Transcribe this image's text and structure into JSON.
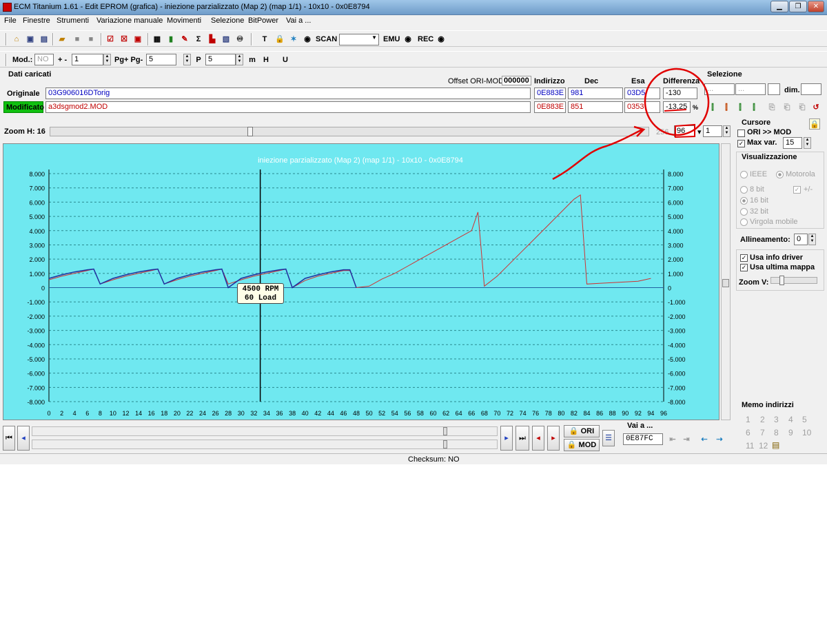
{
  "window": {
    "title": "ECM Titanium 1.61 - Edit EPROM (grafica) - iniezione parzializzato (Map 2) (map 1/1) - 10x10 - 0x0E8794"
  },
  "menu": [
    "File",
    "Finestre",
    "Strumenti",
    "Variazione manuale",
    "Movimenti",
    "Selezione",
    "BitPower",
    "Vai a ..."
  ],
  "toolbar": {
    "scan": "SCAN",
    "emu": "EMU",
    "rec": "REC",
    "mod_label": "Mod.:",
    "mod_value": "NO",
    "plus_minus": "+ -",
    "step1": "1",
    "pg": "Pg+ Pg-",
    "step2": "5",
    "step3": "5"
  },
  "data": {
    "section": "Dati caricati",
    "offset_label": "Offset ORI-MOD",
    "offset_value": "000000",
    "col_indirizzo": "Indirizzo",
    "col_dec": "Dec",
    "col_esa": "Esa",
    "col_diff": "Differenza",
    "ori": {
      "label": "Originale",
      "file": "03G906016DTorig",
      "addr": "0E883E",
      "dec": "981",
      "hex": "03D5",
      "diff": "-130"
    },
    "mod": {
      "label": "Modificato",
      "file": "a3dsgmod2.MOD",
      "addr": "0E883E",
      "dec": "851",
      "hex": "0353",
      "diff": "-13,25",
      "unit": "%"
    }
  },
  "selection": {
    "title": "Selezione",
    "f1": "...",
    "f2": "...",
    "dim": "dim."
  },
  "zoom": {
    "label": "Zoom H: 16",
    "max": "256",
    "value": "96",
    "page": "1"
  },
  "cursor": {
    "title": "Cursore",
    "ori_mod": "ORI >> MOD",
    "max_var": "Max var.",
    "max_var_value": "15"
  },
  "view": {
    "title": "Visualizzazione",
    "ieee": "IEEE",
    "motorola": "Motorola",
    "b8": "8 bit",
    "pm": "+/-",
    "b16": "16 bit",
    "b32": "32 bit",
    "float": "Virgola mobile",
    "align_label": "Allineamento:",
    "align_value": "0",
    "driver": "Usa info driver",
    "last_map": "Usa ultima mappa",
    "zoomv": "Zoom V:"
  },
  "memo": {
    "title": "Memo indirizzi",
    "n": [
      "1",
      "2",
      "3",
      "4",
      "5",
      "6",
      "7",
      "8",
      "9",
      "10",
      "11",
      "12"
    ]
  },
  "nav": {
    "ori": "ORI",
    "mod": "MOD",
    "goto_label": "Vai a ...",
    "goto_value": "0E87FC"
  },
  "status": {
    "checksum": "Checksum: NO"
  },
  "tooltip": {
    "line1": "4500 RPM",
    "line2": "60 Load"
  },
  "chart_data": {
    "type": "line",
    "title": "iniezione parzializzato (Map 2) (map 1/1) - 10x10 - 0x0E8794",
    "xlim": [
      0,
      96
    ],
    "ylim": [
      -8000,
      8000
    ],
    "grid": true,
    "x_ticks": [
      0,
      2,
      4,
      6,
      8,
      10,
      12,
      14,
      16,
      18,
      20,
      22,
      24,
      26,
      28,
      30,
      32,
      34,
      36,
      38,
      40,
      42,
      44,
      46,
      48,
      50,
      52,
      54,
      56,
      58,
      60,
      62,
      64,
      66,
      68,
      70,
      72,
      74,
      76,
      78,
      80,
      82,
      84,
      86,
      88,
      90,
      92,
      94,
      96
    ],
    "y_ticks": [
      "8.000",
      "7.000",
      "6.000",
      "5.000",
      "4.000",
      "3.000",
      "2.000",
      "1.000",
      "0",
      "-1.000",
      "-2.000",
      "-3.000",
      "-4.000",
      "-5.000",
      "-6.000",
      "-7.000",
      "-8.000"
    ],
    "cursor_x": 33,
    "series": [
      {
        "color": "#d03030",
        "x": [
          0,
          2,
          4,
          6,
          7,
          8,
          10,
          12,
          14,
          16,
          17,
          18,
          20,
          22,
          24,
          26,
          27,
          28,
          30,
          32,
          34,
          36,
          37,
          38,
          40,
          42,
          44,
          46,
          47,
          48,
          50,
          52,
          54,
          56,
          58,
          60,
          62,
          64,
          66,
          67,
          68,
          70,
          72,
          74,
          76,
          78,
          80,
          82,
          83,
          84,
          86,
          88,
          90,
          92,
          94
        ],
        "y": [
          550,
          800,
          1000,
          1200,
          1300,
          250,
          550,
          800,
          1000,
          1200,
          1300,
          250,
          550,
          800,
          1000,
          1200,
          1300,
          250,
          550,
          800,
          1000,
          1200,
          1300,
          0,
          500,
          800,
          1000,
          1200,
          1200,
          0,
          100,
          600,
          1000,
          1500,
          2000,
          2500,
          3000,
          3500,
          4000,
          5300,
          100,
          800,
          1700,
          2600,
          3500,
          4400,
          5300,
          6200,
          6500,
          250,
          300,
          350,
          400,
          450,
          650
        ]
      },
      {
        "color": "#2030a0",
        "x": [
          0,
          2,
          4,
          6,
          7,
          8,
          10,
          12,
          14,
          16,
          17,
          18,
          20,
          22,
          24,
          26,
          27,
          28,
          30,
          32,
          34,
          36,
          37,
          38,
          40,
          42,
          44,
          46,
          47,
          48
        ],
        "y": [
          650,
          900,
          1100,
          1250,
          1300,
          250,
          650,
          900,
          1100,
          1250,
          1300,
          250,
          650,
          900,
          1100,
          1250,
          1300,
          0,
          650,
          900,
          1100,
          1250,
          1300,
          0,
          650,
          900,
          1100,
          1250,
          1250,
          0
        ]
      }
    ]
  }
}
